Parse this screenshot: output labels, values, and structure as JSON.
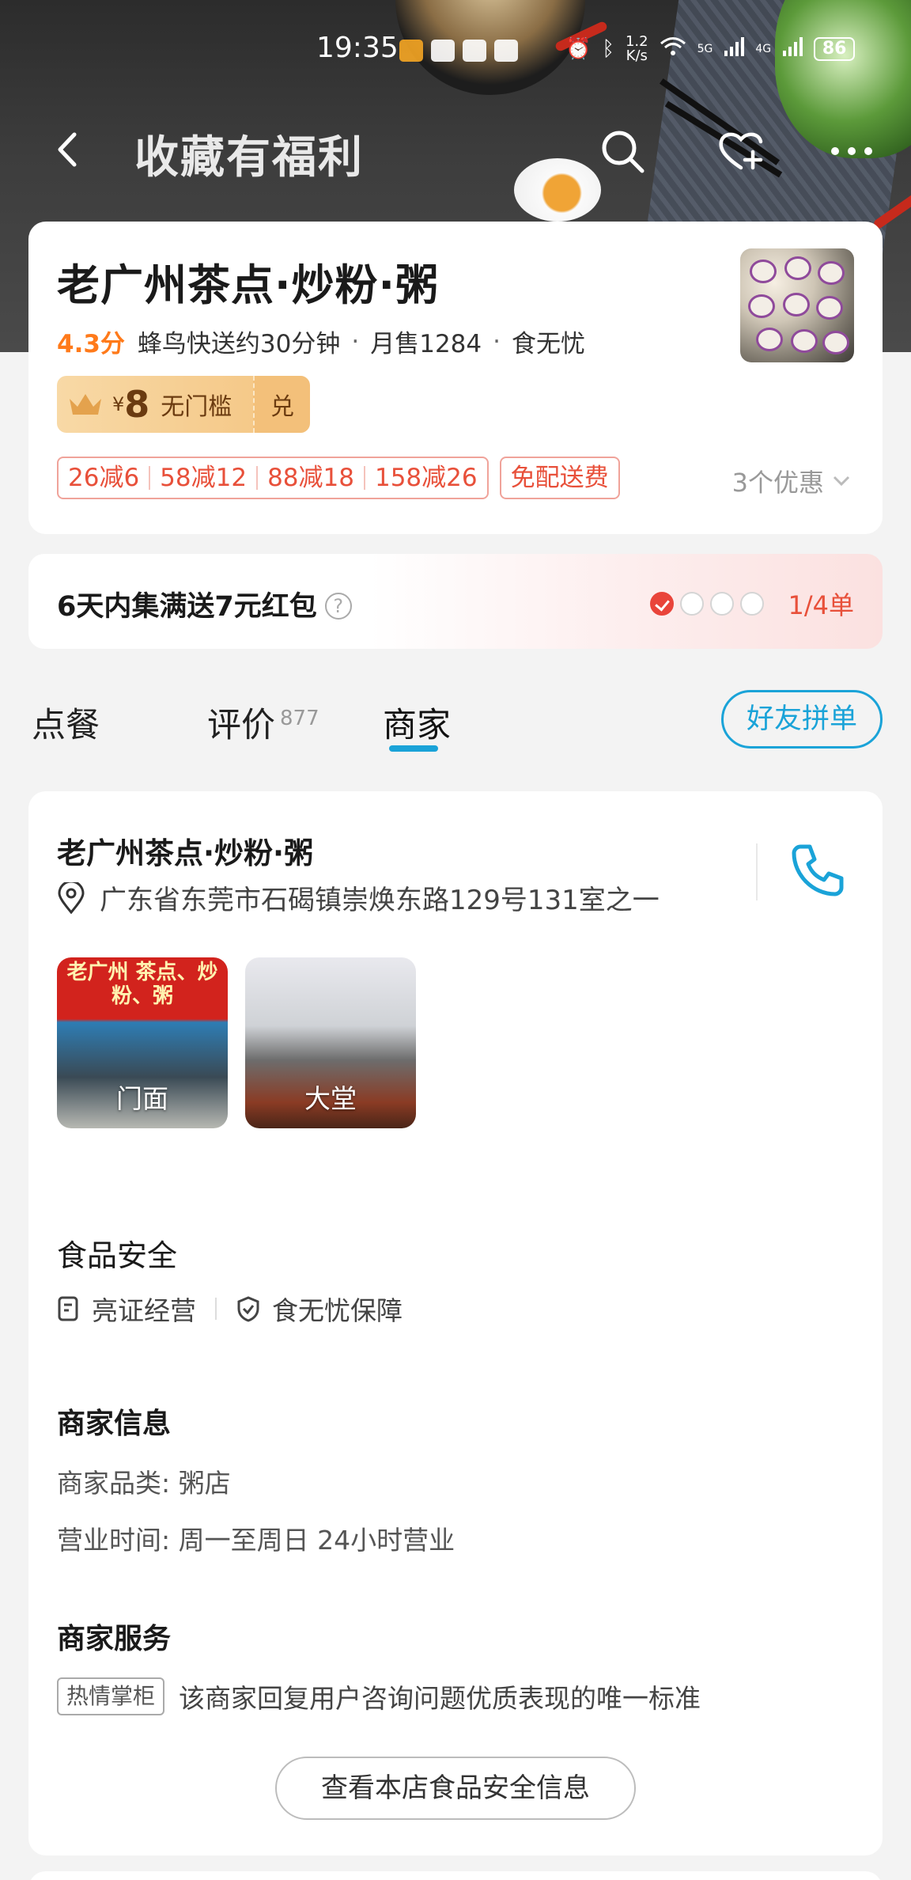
{
  "status_bar": {
    "time": "19:35",
    "speed_value": "1.2",
    "speed_unit": "K/s",
    "net1": "5G",
    "net2": "4G",
    "battery": "86"
  },
  "nav": {
    "title": "收藏有福利"
  },
  "shop": {
    "name": "老广州茶点·炒粉·粥",
    "rating": "4.3分",
    "delivery": "蜂鸟快送约30分钟",
    "monthly_sales": "月售1284",
    "guarantee": "食无忧",
    "coupon": {
      "currency": "¥",
      "amount": "8",
      "condition": "无门槛",
      "redeem": "兑"
    },
    "discounts": [
      "26减6",
      "58减12",
      "88减18",
      "158减26"
    ],
    "free_delivery": "免配送费",
    "offers_label": "3个优惠"
  },
  "red_packet": {
    "text": "6天内集满送7元红包",
    "help": "?",
    "progress": "1/4单",
    "done": 1,
    "total": 4
  },
  "tabs": [
    {
      "label": "点餐"
    },
    {
      "label": "评价",
      "count": "877"
    },
    {
      "label": "商家"
    }
  ],
  "group_order_label": "好友拼单",
  "merchant": {
    "name": "老广州茶点·炒粉·粥",
    "address": "广东省东莞市石碣镇崇焕东路129号131室之一",
    "photos": [
      {
        "caption": "门面",
        "sign": "老广州 茶点、炒粉、粥"
      },
      {
        "caption": "大堂"
      }
    ]
  },
  "food_safety": {
    "title": "食品安全",
    "items": [
      "亮证经营",
      "食无忧保障"
    ]
  },
  "merchant_info": {
    "title": "商家信息",
    "category": "商家品类:  粥店",
    "hours": "营业时间:  周一至周日 24小时营业"
  },
  "merchant_service": {
    "title": "商家服务",
    "tag": "热情掌柜",
    "text": "该商家回复用户咨询问题优质表现的唯一标准"
  },
  "safety_button_label": "查看本店食品安全信息",
  "colors": {
    "accent": "#1aa3d8",
    "rating": "#ff7a1a",
    "discount": "#e8503a"
  }
}
